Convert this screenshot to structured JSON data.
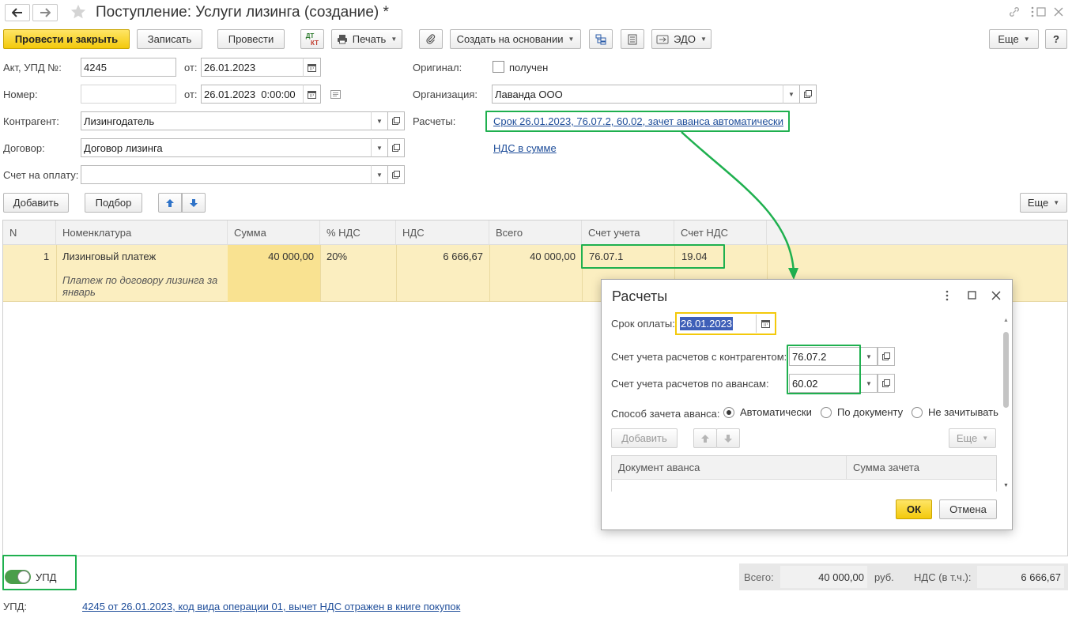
{
  "window": {
    "title": "Поступление: Услуги лизинга (создание) *"
  },
  "toolbar": {
    "post_close": "Провести и закрыть",
    "save": "Записать",
    "post": "Провести",
    "dtkt_top": "ДТ",
    "dtkt_bottom": "КТ",
    "print": "Печать",
    "create_based": "Создать на основании",
    "edo": "ЭДО",
    "more": "Еще",
    "help": "?"
  },
  "form": {
    "act_label": "Акт, УПД №:",
    "act_number": "4245",
    "from_label": "от:",
    "act_date": "26.01.2023",
    "number_label": "Номер:",
    "number_value": "",
    "number_date": "26.01.2023  0:00:00",
    "counterparty_label": "Контрагент:",
    "counterparty": "Лизингодатель",
    "contract_label": "Договор:",
    "contract": "Договор лизинга",
    "invoice_label": "Счет на оплату:",
    "invoice": "",
    "original_label": "Оригинал:",
    "original_checkbox": "получен",
    "org_label": "Организация:",
    "org": "Лаванда ООО",
    "settlements_label": "Расчеты:",
    "settlements_link": "Срок 26.01.2023, 76.07.2, 60.02, зачет аванса автоматически",
    "vat_link": "НДС в сумме"
  },
  "table_toolbar": {
    "add": "Добавить",
    "pick": "Подбор",
    "more": "Еще"
  },
  "table": {
    "columns": [
      "N",
      "Номенклатура",
      "Сумма",
      "% НДС",
      "НДС",
      "Всего",
      "Счет учета",
      "Счет НДС"
    ],
    "rows": [
      {
        "n": "1",
        "item": "Лизинговый платеж",
        "desc_1": "Платеж по договору лизинга за",
        "desc_2": "январь",
        "sum": "40 000,00",
        "vat_pct": "20%",
        "vat": "6 666,67",
        "total": "40 000,00",
        "account": "76.07.1",
        "vat_account": "19.04"
      }
    ]
  },
  "footer": {
    "upd_toggle": "УПД",
    "total_label": "Всего:",
    "total": "40 000,00",
    "currency": "руб.",
    "vat_label": "НДС (в т.ч.):",
    "vat": "6 666,67",
    "upd_label": "УПД:",
    "upd_link": "4245 от 26.01.2023, код вида операции 01, вычет НДС отражен в книге покупок"
  },
  "dialog": {
    "title": "Расчеты",
    "due_label": "Срок оплаты:",
    "due_date": "26.01.2023",
    "acc_counterparty_label": "Счет учета расчетов с контрагентом:",
    "acc_counterparty": "76.07.2",
    "acc_advance_label": "Счет учета расчетов по авансам:",
    "acc_advance": "60.02",
    "offset_label": "Способ зачета аванса:",
    "opt_auto": "Автоматически",
    "opt_doc": "По документу",
    "opt_none": "Не зачитывать",
    "add": "Добавить",
    "more": "Еще",
    "col_doc": "Документ аванса",
    "col_sum": "Сумма зачета",
    "ok": "ОК",
    "cancel": "Отмена"
  },
  "colors": {
    "highlight": "#1fb04f",
    "row_bg": "#fbeec0",
    "accent": "#f3c90b",
    "link": "#1f4e9a"
  }
}
